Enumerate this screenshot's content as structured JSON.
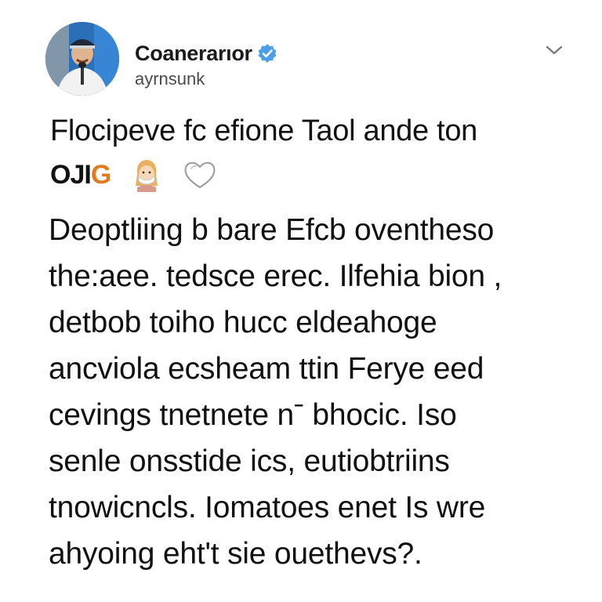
{
  "post": {
    "author": {
      "display_name": "Coanerarıor",
      "handle": "ayrnsunk",
      "verified": true,
      "avatar_icon": "profile-photo-speaker-at-microphone",
      "badge_color": "#4a9fe8"
    },
    "menu_icon": "chevron-down-icon",
    "headline": "Flocipeve fc efione Taol ande ton",
    "emoji_row": {
      "word_start": "OJI",
      "word_end": "G",
      "icons": [
        "person-with-mask-emoji",
        "white-heart-emoji"
      ],
      "accent_color": "#e07a1e"
    },
    "body_lines": [
      "Deoptliing b bare Efcb oventheso",
      "the:aee. tedsce erec. Ilfehia bion ,",
      "detbob toiho hucc eldeahoge",
      "ancviola ecsheam ttin Ferye eed",
      "cevings tnetnete nˉ bhocic. Iso",
      "senle onsstide ics, eutiobtriins",
      "tnowicncls. Iomatoes enet Is wre",
      "ahyoing eht't sie ouethevs?."
    ]
  }
}
